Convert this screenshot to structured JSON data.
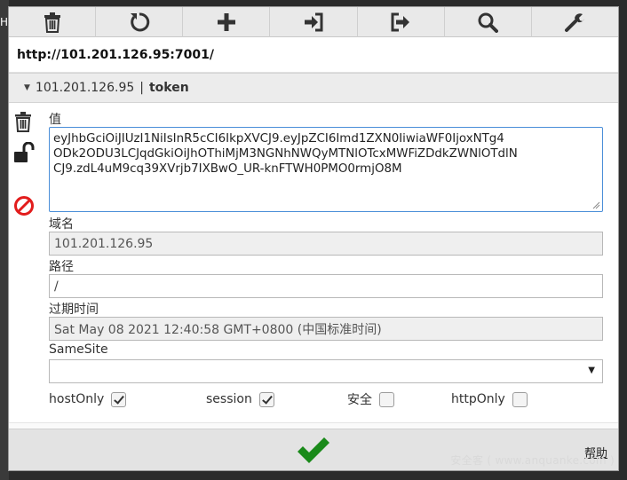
{
  "toolbar": {
    "buttons": [
      {
        "icon": "trash-icon"
      },
      {
        "icon": "refresh-icon"
      },
      {
        "icon": "plus-icon"
      },
      {
        "icon": "import-icon"
      },
      {
        "icon": "export-icon"
      },
      {
        "icon": "search-icon"
      },
      {
        "icon": "wrench-icon"
      }
    ]
  },
  "background_fragment": "H",
  "url": "http://101.201.126.95:7001/",
  "cookie": {
    "domain": "101.201.126.95",
    "separator": "|",
    "name": "token"
  },
  "fields": {
    "value_label": "值",
    "value_lines": [
      "eyJhbGciOiJIUzI1NiIsInR5cCI6IkpXVCJ9.eyJpZCI6Imd1ZXN0IiwiaWF0IjoxNTg4",
      "ODk2ODU3LCJqdGkiOiJhOThiMjM3NGNhNWQyMTNlOTcxMWFiZDdkZWNlOTdlN",
      "CJ9.zdL4uM9cq39XVrjb7IXBwO_UR-knFTWH0PMO0rmjO8M"
    ],
    "domain_label": "域名",
    "domain_value": "101.201.126.95",
    "path_label": "路径",
    "path_value": "/",
    "expires_label": "过期时间",
    "expires_value": "Sat May 08 2021 12:40:58 GMT+0800 (中国标准时间)",
    "samesite_label": "SameSite",
    "samesite_value": ""
  },
  "checkboxes": [
    {
      "label": "hostOnly",
      "checked": true
    },
    {
      "label": "session",
      "checked": true
    },
    {
      "label": "安全",
      "checked": false
    },
    {
      "label": "httpOnly",
      "checked": false
    }
  ],
  "footer": {
    "help_label": "帮助"
  },
  "watermark": "安全客 ( www.anquanke.com )",
  "colors": {
    "save_check": "#1a8a1a",
    "delete_red": "#e21c1c",
    "focus_border": "#4a8ed8"
  }
}
